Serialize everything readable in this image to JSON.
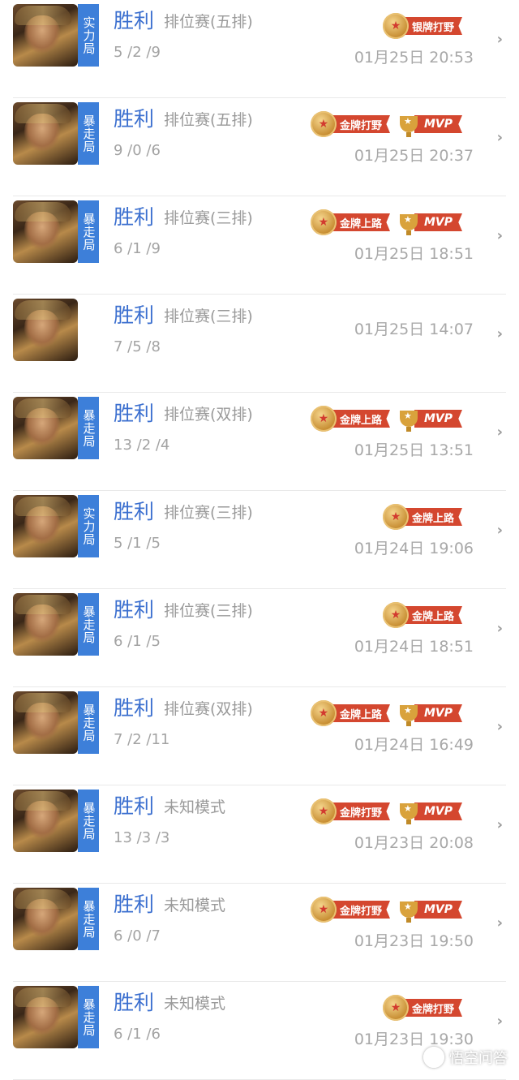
{
  "rows": [
    {
      "tag": "实力局",
      "result": "胜利",
      "mode": "排位赛(五排)",
      "kda": "5 /2 /9",
      "time": "01月25日 20:53",
      "badges": [
        {
          "type": "medal",
          "label": "银牌打野"
        }
      ]
    },
    {
      "tag": "暴走局",
      "result": "胜利",
      "mode": "排位赛(五排)",
      "kda": "9 /0 /6",
      "time": "01月25日 20:37",
      "badges": [
        {
          "type": "medal",
          "label": "金牌打野"
        },
        {
          "type": "mvp",
          "label": "MVP"
        }
      ]
    },
    {
      "tag": "暴走局",
      "result": "胜利",
      "mode": "排位赛(三排)",
      "kda": "6 /1 /9",
      "time": "01月25日 18:51",
      "badges": [
        {
          "type": "medal",
          "label": "金牌上路"
        },
        {
          "type": "mvp",
          "label": "MVP"
        }
      ]
    },
    {
      "tag": "",
      "result": "胜利",
      "mode": "排位赛(三排)",
      "kda": "7 /5 /8",
      "time": "01月25日 14:07",
      "badges": []
    },
    {
      "tag": "暴走局",
      "result": "胜利",
      "mode": "排位赛(双排)",
      "kda": "13 /2 /4",
      "time": "01月25日 13:51",
      "badges": [
        {
          "type": "medal",
          "label": "金牌上路"
        },
        {
          "type": "mvp",
          "label": "MVP"
        }
      ]
    },
    {
      "tag": "实力局",
      "result": "胜利",
      "mode": "排位赛(三排)",
      "kda": "5 /1 /5",
      "time": "01月24日 19:06",
      "badges": [
        {
          "type": "medal",
          "label": "金牌上路"
        }
      ]
    },
    {
      "tag": "暴走局",
      "result": "胜利",
      "mode": "排位赛(三排)",
      "kda": "6 /1 /5",
      "time": "01月24日 18:51",
      "badges": [
        {
          "type": "medal",
          "label": "金牌上路"
        }
      ]
    },
    {
      "tag": "暴走局",
      "result": "胜利",
      "mode": "排位赛(双排)",
      "kda": "7 /2 /11",
      "time": "01月24日 16:49",
      "badges": [
        {
          "type": "medal",
          "label": "金牌上路"
        },
        {
          "type": "mvp",
          "label": "MVP"
        }
      ]
    },
    {
      "tag": "暴走局",
      "result": "胜利",
      "mode": "未知模式",
      "kda": "13 /3 /3",
      "time": "01月23日 20:08",
      "badges": [
        {
          "type": "medal",
          "label": "金牌打野"
        },
        {
          "type": "mvp",
          "label": "MVP"
        }
      ]
    },
    {
      "tag": "暴走局",
      "result": "胜利",
      "mode": "未知模式",
      "kda": "6 /0 /7",
      "time": "01月23日 19:50",
      "badges": [
        {
          "type": "medal",
          "label": "金牌打野"
        },
        {
          "type": "mvp",
          "label": "MVP"
        }
      ]
    },
    {
      "tag": "暴走局",
      "result": "胜利",
      "mode": "未知模式",
      "kda": "6 /1 /6",
      "time": "01月23日 19:30",
      "badges": [
        {
          "type": "medal",
          "label": "金牌打野"
        }
      ]
    }
  ],
  "chevron_icon": "chevron-right-icon",
  "watermark": {
    "text": "悟空问答"
  },
  "colors": {
    "result": "#3b6fcf",
    "tag_bg": "#3d7fd9",
    "ribbon": "#d4472f",
    "medal_gold": "#c58a2e"
  }
}
